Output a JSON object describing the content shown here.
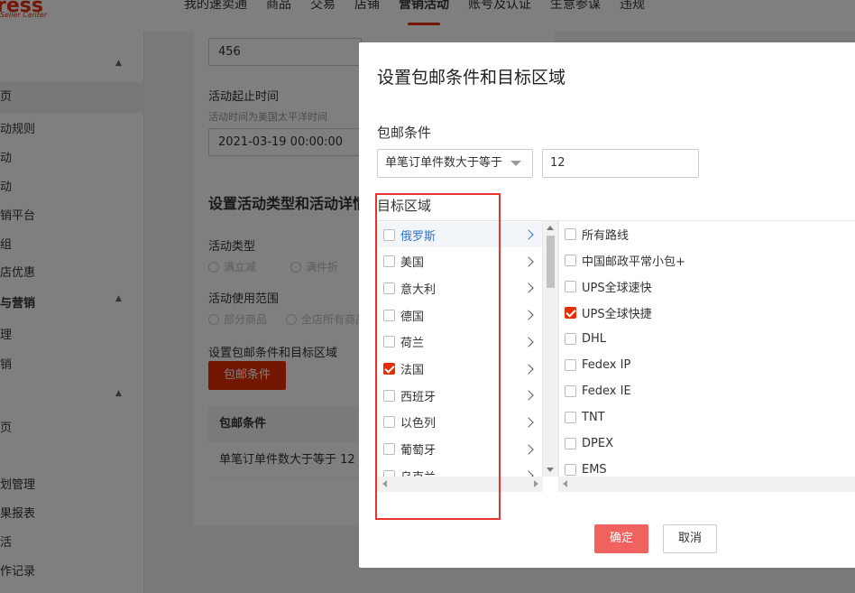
{
  "topbar": {
    "logo_text": "ress",
    "logo_sub": "Seller Center",
    "nav": [
      "我的速卖通",
      "商品",
      "交易",
      "店铺",
      "营销活动",
      "账号及认证",
      "生意参谋",
      "违规"
    ],
    "active_index": 4
  },
  "sidebar": {
    "items": [
      "页",
      "动规则",
      "动",
      "动",
      "销平台",
      "组",
      "店优惠",
      "与营销",
      "理",
      "销",
      "页",
      "划管理",
      "果报表",
      "活",
      "作记录"
    ]
  },
  "bg_form": {
    "name_value": "456",
    "time_label": "活动起止时间",
    "time_hint": "活动时间为美国太平洋时间",
    "time_value": "2021-03-19 00:00:00",
    "section_title": "设置活动类型和活动详情",
    "type_label": "活动类型",
    "type_options": [
      "满立减",
      "满件折"
    ],
    "scope_label": "活动使用范围",
    "scope_options": [
      "部分商品",
      "全店所有商品"
    ],
    "shipping_label": "设置包邮条件和目标区域",
    "shipping_button": "包邮条件",
    "table_header": "包邮条件",
    "table_cell": "单笔订单件数大于等于 12"
  },
  "modal": {
    "title": "设置包邮条件和目标区域",
    "condition_label": "包邮条件",
    "condition_select": "单笔订单件数大于等于",
    "condition_value": "12",
    "region_label": "目标区域",
    "countries": [
      {
        "name": "俄罗斯",
        "checked": false,
        "active": true
      },
      {
        "name": "美国",
        "checked": false,
        "active": false
      },
      {
        "name": "意大利",
        "checked": false,
        "active": false
      },
      {
        "name": "德国",
        "checked": false,
        "active": false
      },
      {
        "name": "荷兰",
        "checked": false,
        "active": false
      },
      {
        "name": "法国",
        "checked": true,
        "active": false
      },
      {
        "name": "西班牙",
        "checked": false,
        "active": false
      },
      {
        "name": "以色列",
        "checked": false,
        "active": false
      },
      {
        "name": "葡萄牙",
        "checked": false,
        "active": false
      },
      {
        "name": "乌克兰",
        "checked": false,
        "active": false
      }
    ],
    "routes": [
      {
        "name": "所有路线",
        "checked": false
      },
      {
        "name": "中国邮政平常小包+",
        "checked": false
      },
      {
        "name": "UPS全球速快",
        "checked": false
      },
      {
        "name": "UPS全球快捷",
        "checked": true
      },
      {
        "name": "DHL",
        "checked": false
      },
      {
        "name": "Fedex IP",
        "checked": false
      },
      {
        "name": "Fedex IE",
        "checked": false
      },
      {
        "name": "TNT",
        "checked": false
      },
      {
        "name": "DPEX",
        "checked": false
      },
      {
        "name": "EMS",
        "checked": false
      }
    ],
    "ok_label": "确定",
    "cancel_label": "取消"
  },
  "colors": {
    "brand": "#e62e04",
    "ok_button": "#f0625f",
    "highlight_frame": "#e8342f",
    "active_link": "#3476c9"
  }
}
